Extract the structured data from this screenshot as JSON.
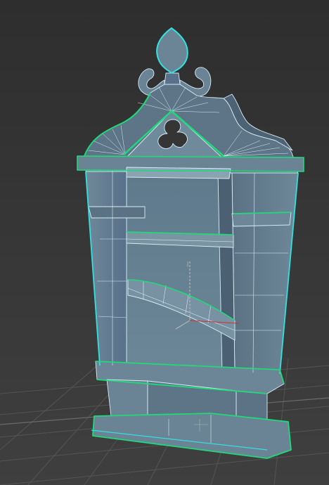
{
  "viewport": {
    "kind": "3d-perspective-viewport",
    "object": "gothic-cabinet-model",
    "display_mode": "shaded-with-wireframe-edges",
    "selection_state": "selected",
    "colors": {
      "background": "#3b3b3b",
      "grid": "#5a5a5a",
      "mesh_fill": "#5c7385",
      "mesh_fill_dark": "#4a5f70",
      "mesh_fill_light": "#7890a0",
      "inner_panel": "#6a8595",
      "wire_edge": "#d8eef6",
      "selection_outline": "#1fd97a",
      "selection_outline_alt": "#33e0e0",
      "gizmo_x": "#d13030",
      "gizmo_y": "#c0c0c0"
    }
  }
}
